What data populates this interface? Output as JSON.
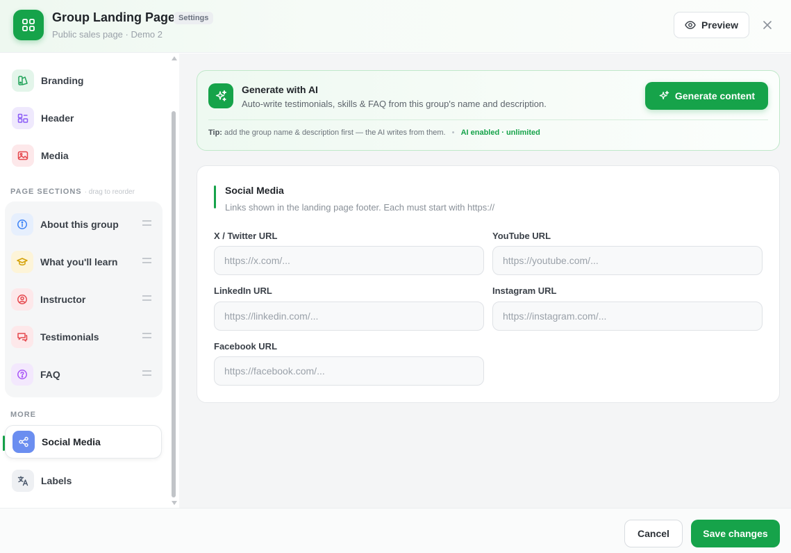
{
  "header": {
    "title": "Group Landing Page",
    "badge": "Settings",
    "subtitle": "Public sales page · Demo 2",
    "preview_label": "Preview"
  },
  "sidebar": {
    "top_items": [
      {
        "label": "Branding",
        "icon": "branding-icon",
        "color": "#22a35a"
      },
      {
        "label": "Header",
        "icon": "header-layout-icon",
        "color": "#8b5cf6"
      },
      {
        "label": "Media",
        "icon": "image-icon",
        "color": "#e5484d"
      }
    ],
    "page_sections_label": "PAGE SECTIONS",
    "page_sections_hint": "· drag to reorder",
    "sections": [
      {
        "label": "About this group",
        "icon": "info-icon",
        "color": "#3b82f6"
      },
      {
        "label": "What you'll learn",
        "icon": "graduation-cap-icon",
        "color": "#eab308"
      },
      {
        "label": "Instructor",
        "icon": "user-circle-icon",
        "color": "#e5484d"
      },
      {
        "label": "Testimonials",
        "icon": "chat-bubbles-icon",
        "color": "#e5484d"
      },
      {
        "label": "FAQ",
        "icon": "help-circle-icon",
        "color": "#a855f7"
      }
    ],
    "more_label": "MORE",
    "more_items": [
      {
        "label": "Social Media",
        "icon": "share-icon",
        "color": "#6366f1",
        "active": true
      },
      {
        "label": "Labels",
        "icon": "translate-icon",
        "color": "#475569",
        "active": false
      }
    ]
  },
  "ai": {
    "title": "Generate with AI",
    "description": "Auto-write testimonials, skills & FAQ from this group's name and description.",
    "button_label": "Generate content",
    "tip_prefix": "Tip:",
    "tip_text": "add the group name & description first — the AI writes from them.",
    "status": "AI enabled · unlimited"
  },
  "form": {
    "title": "Social Media",
    "description": "Links shown in the landing page footer. Each must start with https://",
    "fields": [
      {
        "label": "X / Twitter URL",
        "placeholder": "https://x.com/...",
        "value": ""
      },
      {
        "label": "YouTube URL",
        "placeholder": "https://youtube.com/...",
        "value": ""
      },
      {
        "label": "LinkedIn URL",
        "placeholder": "https://linkedin.com/...",
        "value": ""
      },
      {
        "label": "Instagram URL",
        "placeholder": "https://instagram.com/...",
        "value": ""
      },
      {
        "label": "Facebook URL",
        "placeholder": "https://facebook.com/...",
        "value": ""
      }
    ]
  },
  "footer": {
    "cancel_label": "Cancel",
    "save_label": "Save changes"
  },
  "colors": {
    "accent": "#16a34a"
  }
}
